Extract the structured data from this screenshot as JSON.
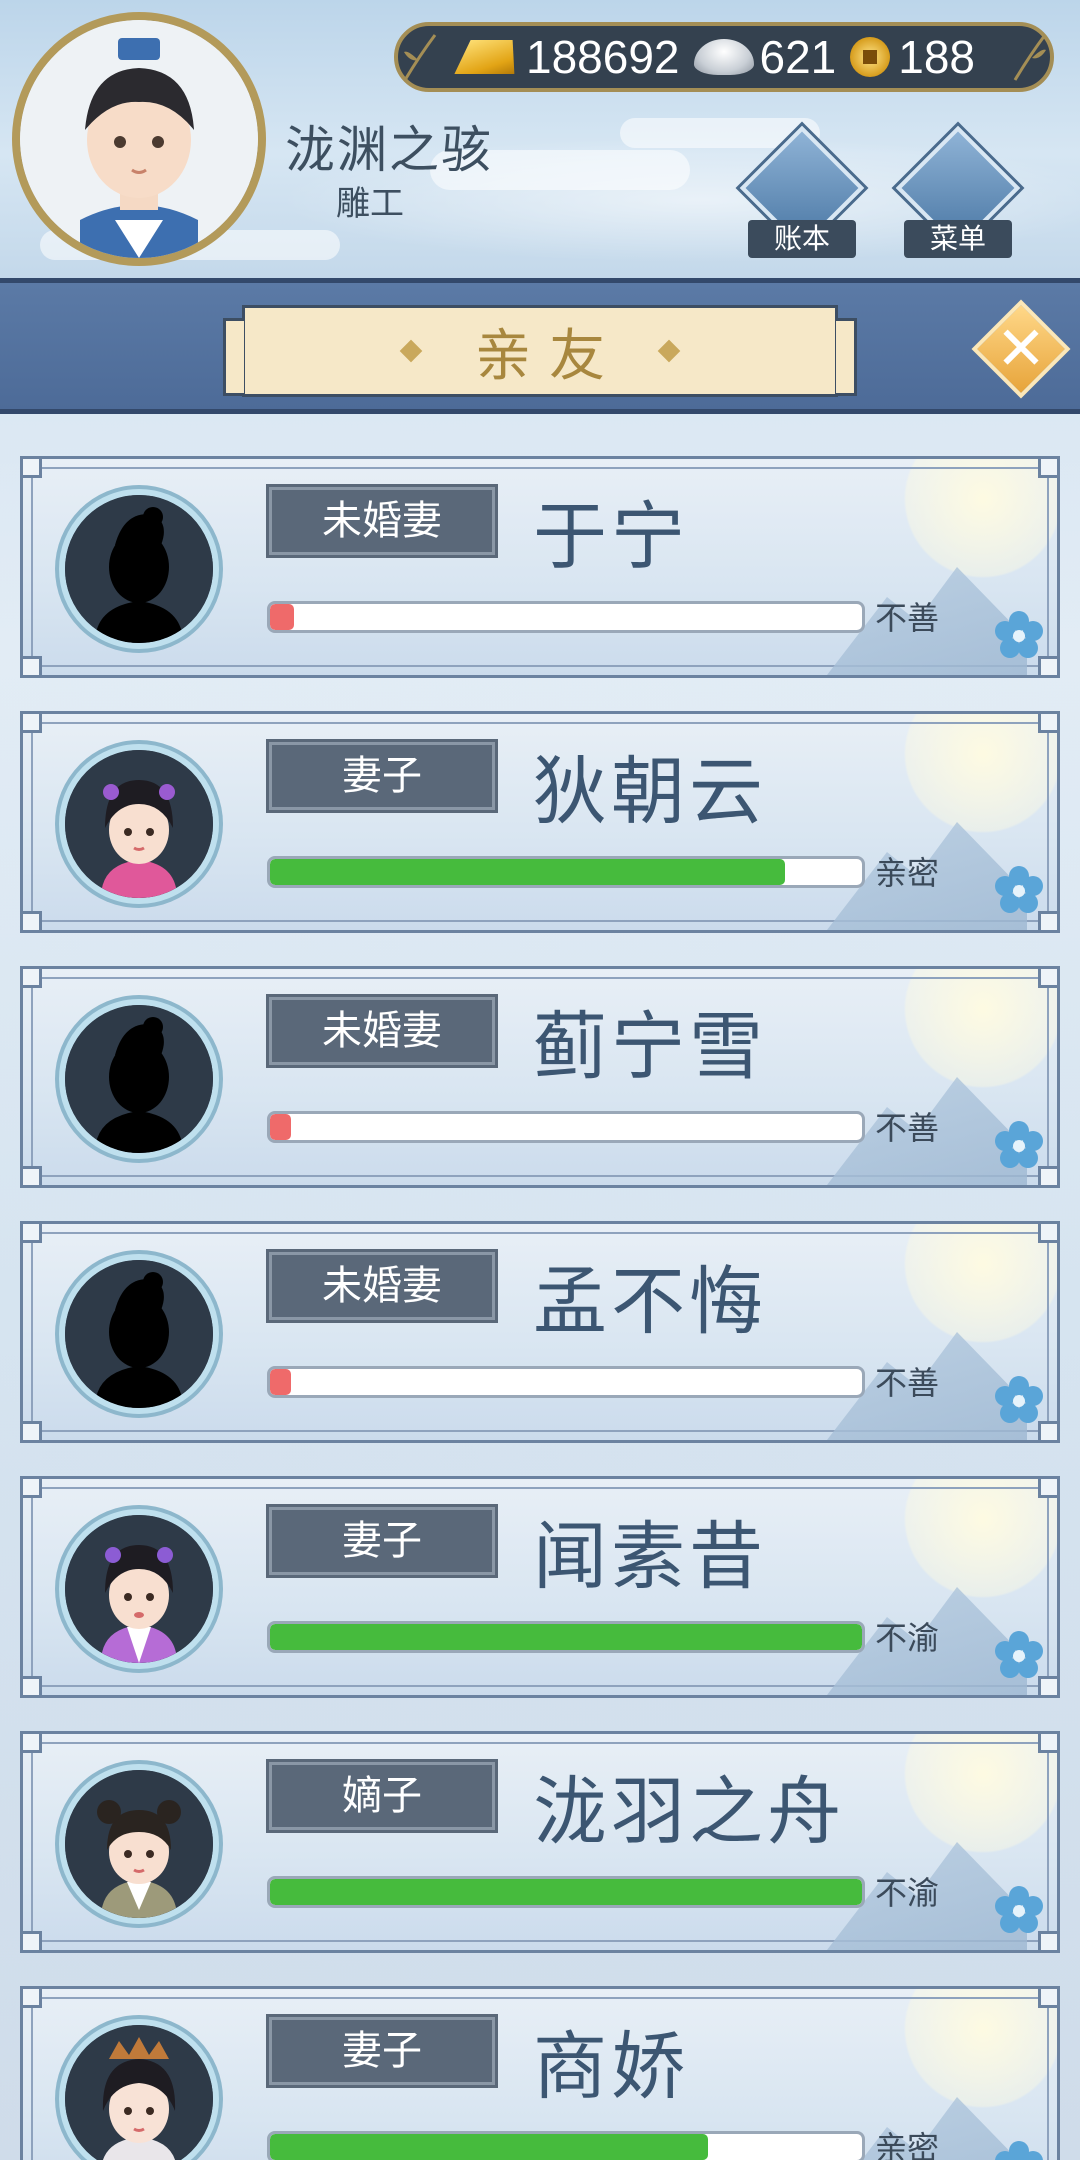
{
  "player": {
    "name": "泷渊之骇",
    "title": "雕工"
  },
  "currency": {
    "gold": "188692",
    "silver": "621",
    "coins": "188"
  },
  "hud": {
    "ledger_label": "账本",
    "menu_label": "菜单"
  },
  "banner": {
    "title": "亲友"
  },
  "colors": {
    "bar_red": "#ef6a6a",
    "bar_green": "#46bb3d",
    "banner_blue": "#4d6b98",
    "tag_bg": "#5a6879"
  },
  "relatives": [
    {
      "relation": "未婚妻",
      "name": "于宁",
      "status": "不善",
      "affinity": 0.04,
      "bar_color": "red",
      "portrait": "silhouette"
    },
    {
      "relation": "妻子",
      "name": "狄朝云",
      "status": "亲密",
      "affinity": 0.87,
      "bar_color": "green",
      "portrait": "woman-pink"
    },
    {
      "relation": "未婚妻",
      "name": "蓟宁雪",
      "status": "不善",
      "affinity": 0.02,
      "bar_color": "red",
      "portrait": "silhouette"
    },
    {
      "relation": "未婚妻",
      "name": "孟不悔",
      "status": "不善",
      "affinity": 0.03,
      "bar_color": "red",
      "portrait": "silhouette"
    },
    {
      "relation": "妻子",
      "name": "闻素昔",
      "status": "不渝",
      "affinity": 1.0,
      "bar_color": "green",
      "portrait": "woman-purple"
    },
    {
      "relation": "嫡子",
      "name": "泷羽之舟",
      "status": "不渝",
      "affinity": 1.0,
      "bar_color": "green",
      "portrait": "boy"
    },
    {
      "relation": "妻子",
      "name": "商娇",
      "status": "亲密",
      "affinity": 0.74,
      "bar_color": "green",
      "portrait": "woman-crown"
    }
  ]
}
